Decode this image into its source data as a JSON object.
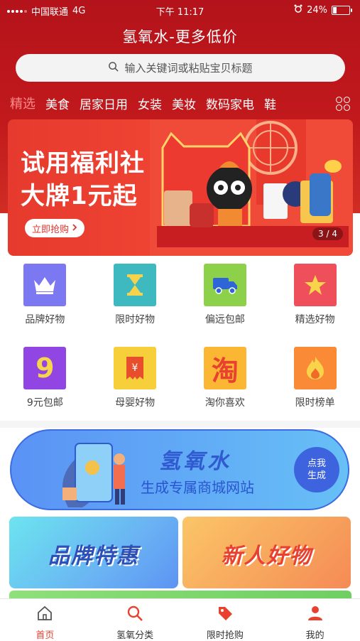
{
  "status_bar": {
    "carrier": "中国联通",
    "network": "4G",
    "time": "下午 11:17",
    "battery_percent": "24%",
    "battery_level": 0.24
  },
  "app_title": "氢氧水-更多低价",
  "search": {
    "placeholder": "输入关键词或粘贴宝贝标题",
    "icon": "search-icon"
  },
  "categories": {
    "items": [
      "精选",
      "美食",
      "居家日用",
      "女装",
      "美妆",
      "数码家电",
      "鞋"
    ],
    "active_index": 0,
    "more_icon": "grid-dots-icon"
  },
  "banner": {
    "line1": "试用福利社",
    "line2": "大牌1元起",
    "cta": "立即抢购",
    "pagination": "3 / 4"
  },
  "shortcuts": [
    {
      "label": "品牌好物",
      "icon": "crown-icon",
      "color": "#7b78f2"
    },
    {
      "label": "限时好物",
      "icon": "hourglass-icon",
      "color": "#3fb9c0"
    },
    {
      "label": "偏远包邮",
      "icon": "truck-icon",
      "color": "#8dd14a"
    },
    {
      "label": "精选好物",
      "icon": "star-icon",
      "color": "#ef4f5a"
    },
    {
      "label": "9元包邮",
      "icon": "nine-icon",
      "color": "#9146e4",
      "glyph": "9"
    },
    {
      "label": "母婴好物",
      "icon": "yen-coupon-icon",
      "color": "#f6cf3a",
      "glyph": "¥"
    },
    {
      "label": "淘你喜欢",
      "icon": "tao-icon",
      "color": "#fbb734",
      "glyph": "淘"
    },
    {
      "label": "限时榜单",
      "icon": "flame-icon",
      "color": "#fb8a36"
    }
  ],
  "promo": {
    "title": "氢氧水",
    "subtitle": "生成专属商城网站",
    "button_line1": "点我",
    "button_line2": "生成"
  },
  "cards": {
    "brand": "品牌特惠",
    "newbie": "新人好物"
  },
  "tabbar": [
    {
      "label": "首页",
      "icon": "home-icon",
      "active": true
    },
    {
      "label": "氢氧分类",
      "icon": "search-icon",
      "active": false
    },
    {
      "label": "限时抢购",
      "icon": "tag-icon",
      "active": false
    },
    {
      "label": "我的",
      "icon": "user-icon",
      "active": false
    }
  ],
  "colors": {
    "header_red": "#c1191c",
    "accent": "#e9412f",
    "promo_blue": "#3e63de"
  }
}
